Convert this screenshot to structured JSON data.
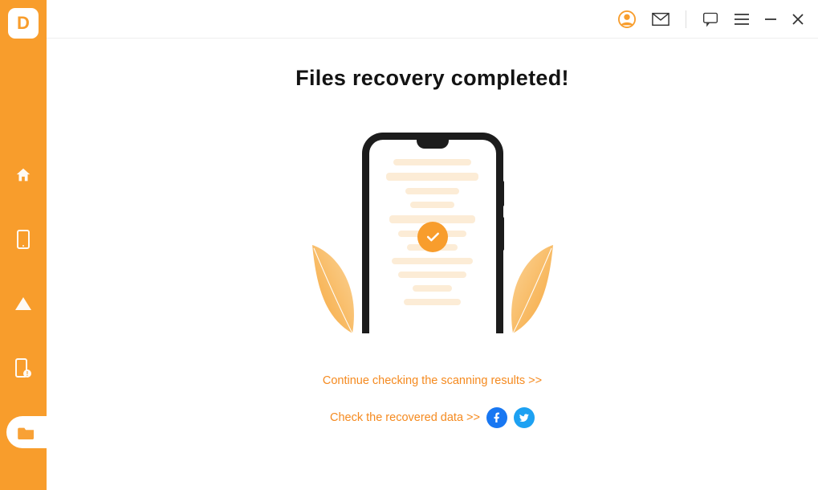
{
  "accent_color": "#f89d2c",
  "sidebar": {
    "logo_letter": "D",
    "items": [
      {
        "name": "home"
      },
      {
        "name": "phone"
      },
      {
        "name": "cloud"
      },
      {
        "name": "phone-alert"
      },
      {
        "name": "folder",
        "active": true
      }
    ]
  },
  "topbar": {
    "icons": [
      "user",
      "mail",
      "feedback",
      "menu",
      "minimize",
      "close"
    ]
  },
  "main": {
    "heading": "Files recovery completed!",
    "link_continue": "Continue checking the scanning results >>",
    "link_recovered": "Check the recovered data >>",
    "social": [
      "facebook",
      "twitter"
    ]
  }
}
